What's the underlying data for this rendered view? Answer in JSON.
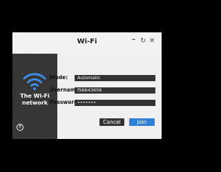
{
  "window": {
    "title": "Wi-Fi",
    "controls": {
      "minimize_icon": "minimize-icon",
      "restore_icon": "restore-icon",
      "close_icon": "close-icon",
      "minimize_glyph": "–",
      "restore_glyph": "↻",
      "close_glyph": "✕"
    }
  },
  "panel": {
    "icon": "wifi-icon",
    "network_text": "The Wi-Fi\nnetwork",
    "help_icon": "help-icon",
    "help_glyph": "?"
  },
  "form": {
    "mode_label": "Mode:",
    "mode_value": "Automatic",
    "username_label": "Username:",
    "username_value": "f56643656",
    "password_label": "Password:",
    "password_value": "•••••••"
  },
  "buttons": {
    "cancel_label": "Cancel",
    "join_label": "Join"
  },
  "colors": {
    "accent": "#2f7fd6",
    "panel_bg": "#303030",
    "field_bg": "#333333"
  }
}
